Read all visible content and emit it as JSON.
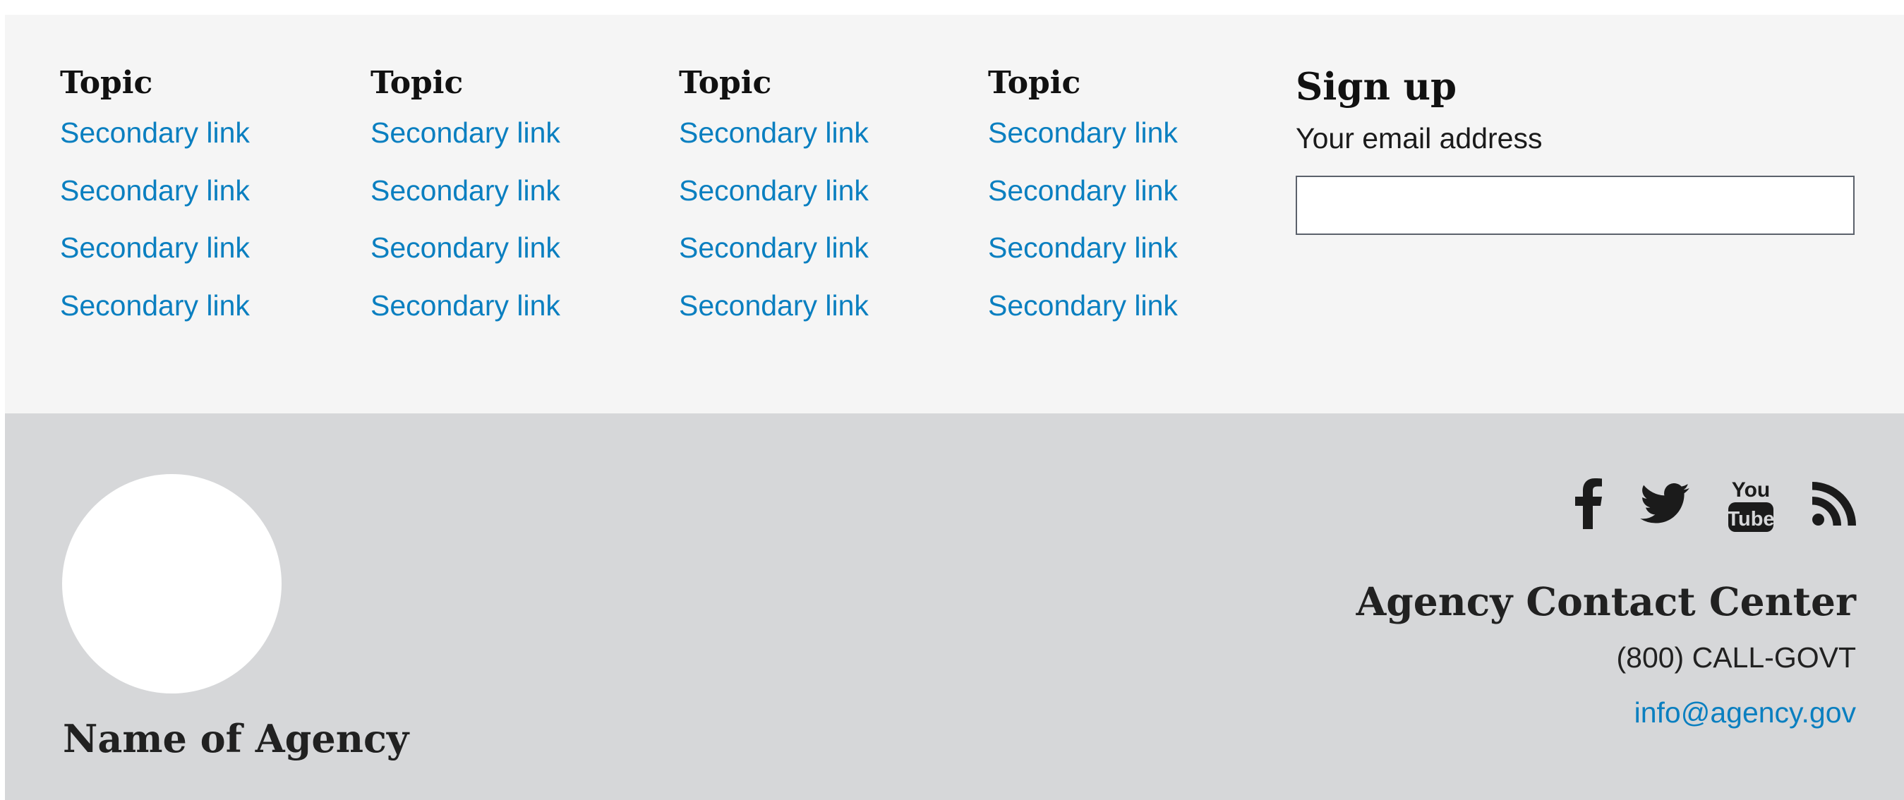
{
  "topics": [
    {
      "heading": "Topic",
      "links": [
        "Secondary link",
        "Secondary link",
        "Secondary link",
        "Secondary link"
      ]
    },
    {
      "heading": "Topic",
      "links": [
        "Secondary link",
        "Secondary link",
        "Secondary link",
        "Secondary link"
      ]
    },
    {
      "heading": "Topic",
      "links": [
        "Secondary link",
        "Secondary link",
        "Secondary link",
        "Secondary link"
      ]
    },
    {
      "heading": "Topic",
      "links": [
        "Secondary link",
        "Secondary link",
        "Secondary link",
        "Secondary link"
      ]
    }
  ],
  "signup": {
    "heading": "Sign up",
    "email_label": "Your email address",
    "email_value": "",
    "email_placeholder": ""
  },
  "agency": {
    "name": "Name of Agency",
    "logo": "agency-logo-placeholder"
  },
  "social": [
    {
      "name": "facebook-icon"
    },
    {
      "name": "twitter-icon"
    },
    {
      "name": "youtube-icon"
    },
    {
      "name": "rss-icon"
    }
  ],
  "contact": {
    "heading": "Agency Contact Center",
    "phone": "(800) CALL-GOVT",
    "email": "info@agency.gov"
  },
  "colors": {
    "link": "#0a7fc0",
    "primary_bg": "#f5f5f5",
    "secondary_bg": "#d6d7d9",
    "text": "#212121"
  }
}
